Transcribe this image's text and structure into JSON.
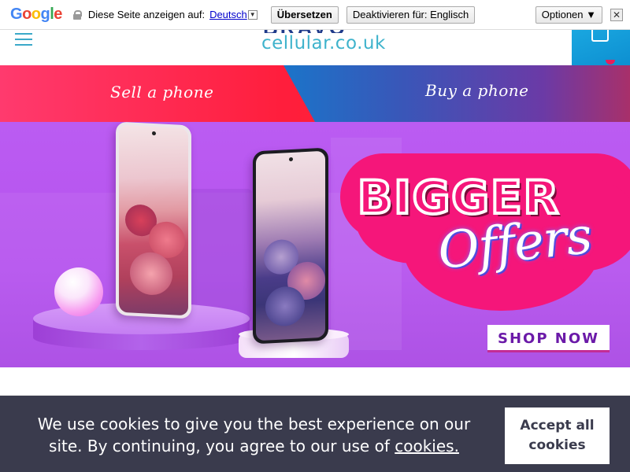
{
  "translate_bar": {
    "brand": "Google",
    "prompt": "Diese Seite anzeigen auf:",
    "language": "Deutsch",
    "translate_button": "Übersetzen",
    "disable_button": "Deaktivieren für: Englisch",
    "options_button": "Optionen ▼",
    "close_glyph": "✕"
  },
  "header": {
    "logo_top": "BRAVO",
    "logo_text": "cellular.co.uk"
  },
  "strip": {
    "sell_label": "Sell a phone",
    "buy_label": "Buy a phone"
  },
  "hero": {
    "headline": "BIGGER",
    "script_text": "Offers",
    "cta": "SHOP NOW"
  },
  "cookie": {
    "message": "We use cookies to give you the best experience on our site. By continuing, you agree to our use of ",
    "link_text": "cookies.",
    "accept_label": "Accept all cookies"
  },
  "colors": {
    "accent_cyan": "#3fb3cc",
    "basket_blue": "#1aa7e0",
    "sell_red": "#ff1e3c",
    "buy_blue": "#1b74c9",
    "hero_purple": "#b552ee",
    "offer_pink": "#f5167a",
    "cookie_bg": "#3a3b4d"
  }
}
